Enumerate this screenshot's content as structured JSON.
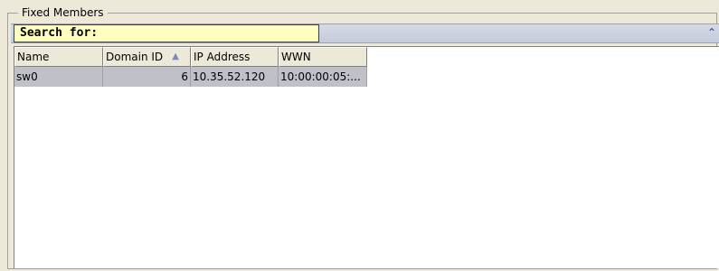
{
  "group": {
    "title": "Fixed Members"
  },
  "search": {
    "label": "Search for:"
  },
  "table": {
    "columns": [
      "Name",
      "Domain ID",
      "IP Address",
      "WWN"
    ],
    "sorted_column": "Domain ID",
    "sort_direction": "ascending",
    "rows": [
      {
        "name": "sw0",
        "domain_id": "6",
        "ip_address": "10.35.52.120",
        "wwn": "10:00:00:05:..."
      }
    ]
  },
  "icons": {
    "sort": "sort-ascending-icon",
    "collapse": "double-chevron-up-icon"
  }
}
